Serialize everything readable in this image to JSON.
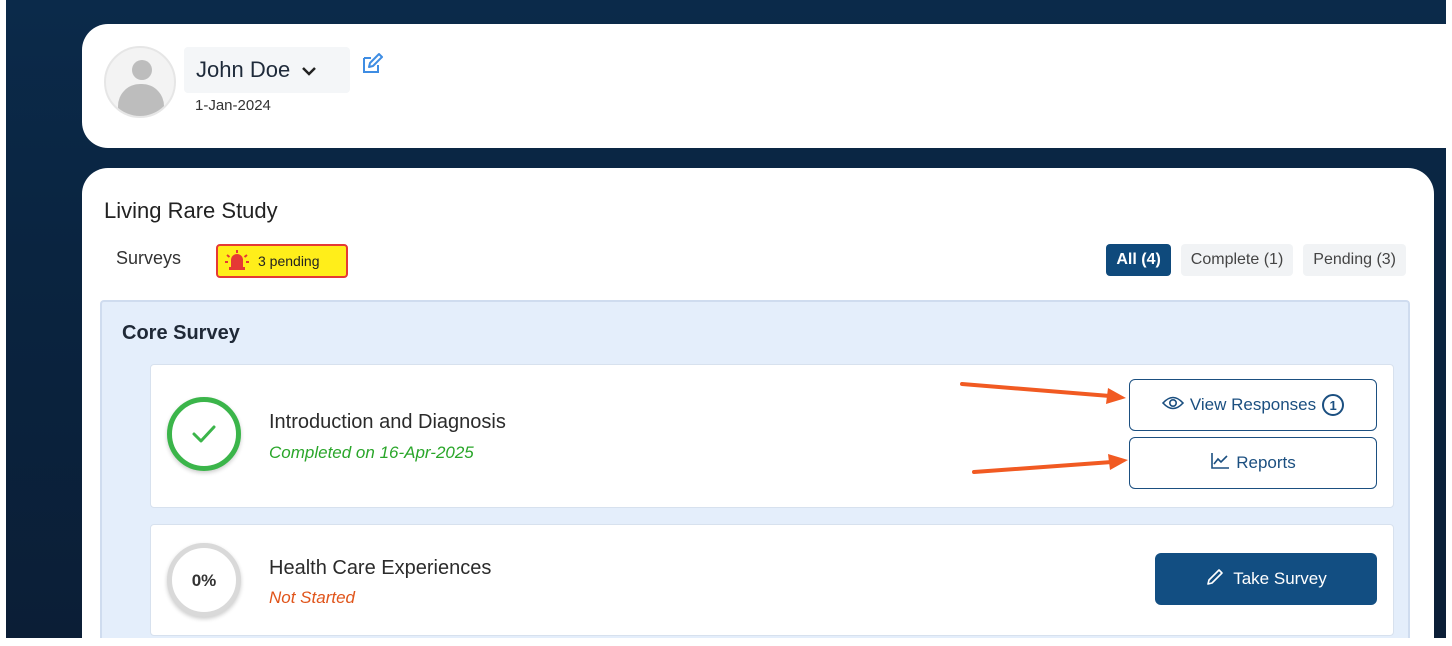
{
  "profile": {
    "user_name": "John Doe",
    "date": "1-Jan-2024",
    "icons": {
      "avatar": "user-avatar-icon",
      "chevron": "chevron-down-icon",
      "edit": "edit-icon"
    }
  },
  "study": {
    "title": "Living Rare Study",
    "surveys_label": "Surveys",
    "pending_badge": "3 pending",
    "filters": [
      {
        "label": "All (4)",
        "active": true
      },
      {
        "label": "Complete (1)",
        "active": false
      },
      {
        "label": "Pending (3)",
        "active": false
      }
    ],
    "section_title": "Core Survey",
    "items": [
      {
        "title": "Introduction and Diagnosis",
        "status": "Completed on 16-Apr-2025",
        "progress_label": "",
        "buttons": {
          "view_responses": "View Responses",
          "responses_count": "1",
          "reports": "Reports"
        }
      },
      {
        "title": "Health Care Experiences",
        "status": "Not Started",
        "progress_label": "0%",
        "buttons": {
          "take_survey": "Take Survey"
        }
      }
    ]
  },
  "colors": {
    "primary": "#124e82",
    "complete_green": "#3bb54a",
    "not_started_orange": "#e0541a",
    "badge_yellow": "#ffee1a",
    "badge_border": "#e53935",
    "annotation_arrow": "#f15a22"
  }
}
